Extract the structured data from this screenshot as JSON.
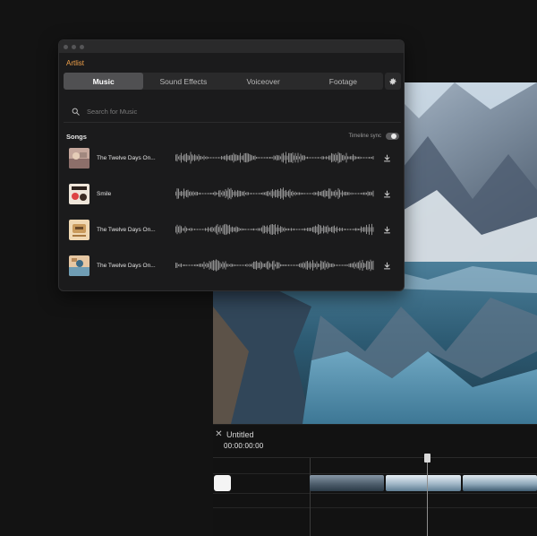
{
  "plugin": {
    "brand": "Artlist",
    "tabs": [
      {
        "label": "Music",
        "active": true
      },
      {
        "label": "Sound Effects",
        "active": false
      },
      {
        "label": "Voiceover",
        "active": false
      },
      {
        "label": "Footage",
        "active": false
      }
    ],
    "settings_icon": "gear-icon",
    "search": {
      "placeholder": "Search for Music",
      "value": "",
      "icon": "search-icon"
    },
    "songs": {
      "title": "Songs",
      "timeline_sync_label": "Timeline sync",
      "timeline_sync_on": false,
      "items": [
        {
          "title": "The Twelve Days On...",
          "cover_colors": [
            "#c9a69a",
            "#8d6e6a",
            "#e3c8b2"
          ],
          "download_icon": "download-icon"
        },
        {
          "title": "Smile",
          "cover_colors": [
            "#efe7dc",
            "#3b2b22",
            "#d44"
          ],
          "download_icon": "download-icon"
        },
        {
          "title": "The Twelve Days On...",
          "cover_colors": [
            "#f1d9b5",
            "#c79a5c",
            "#6b4a2a"
          ],
          "download_icon": "download-icon"
        },
        {
          "title": "The Twelve Days On...",
          "cover_colors": [
            "#e8c9a6",
            "#7aa3b8",
            "#3b6a86"
          ],
          "download_icon": "download-icon"
        }
      ]
    }
  },
  "editor": {
    "project_title": "Untitled",
    "close_icon": "close-icon",
    "timecode": "00:00:00:00"
  },
  "colors": {
    "accent": "#f0a14a",
    "panel_bg": "#1b1b1c",
    "app_bg": "#131313"
  }
}
